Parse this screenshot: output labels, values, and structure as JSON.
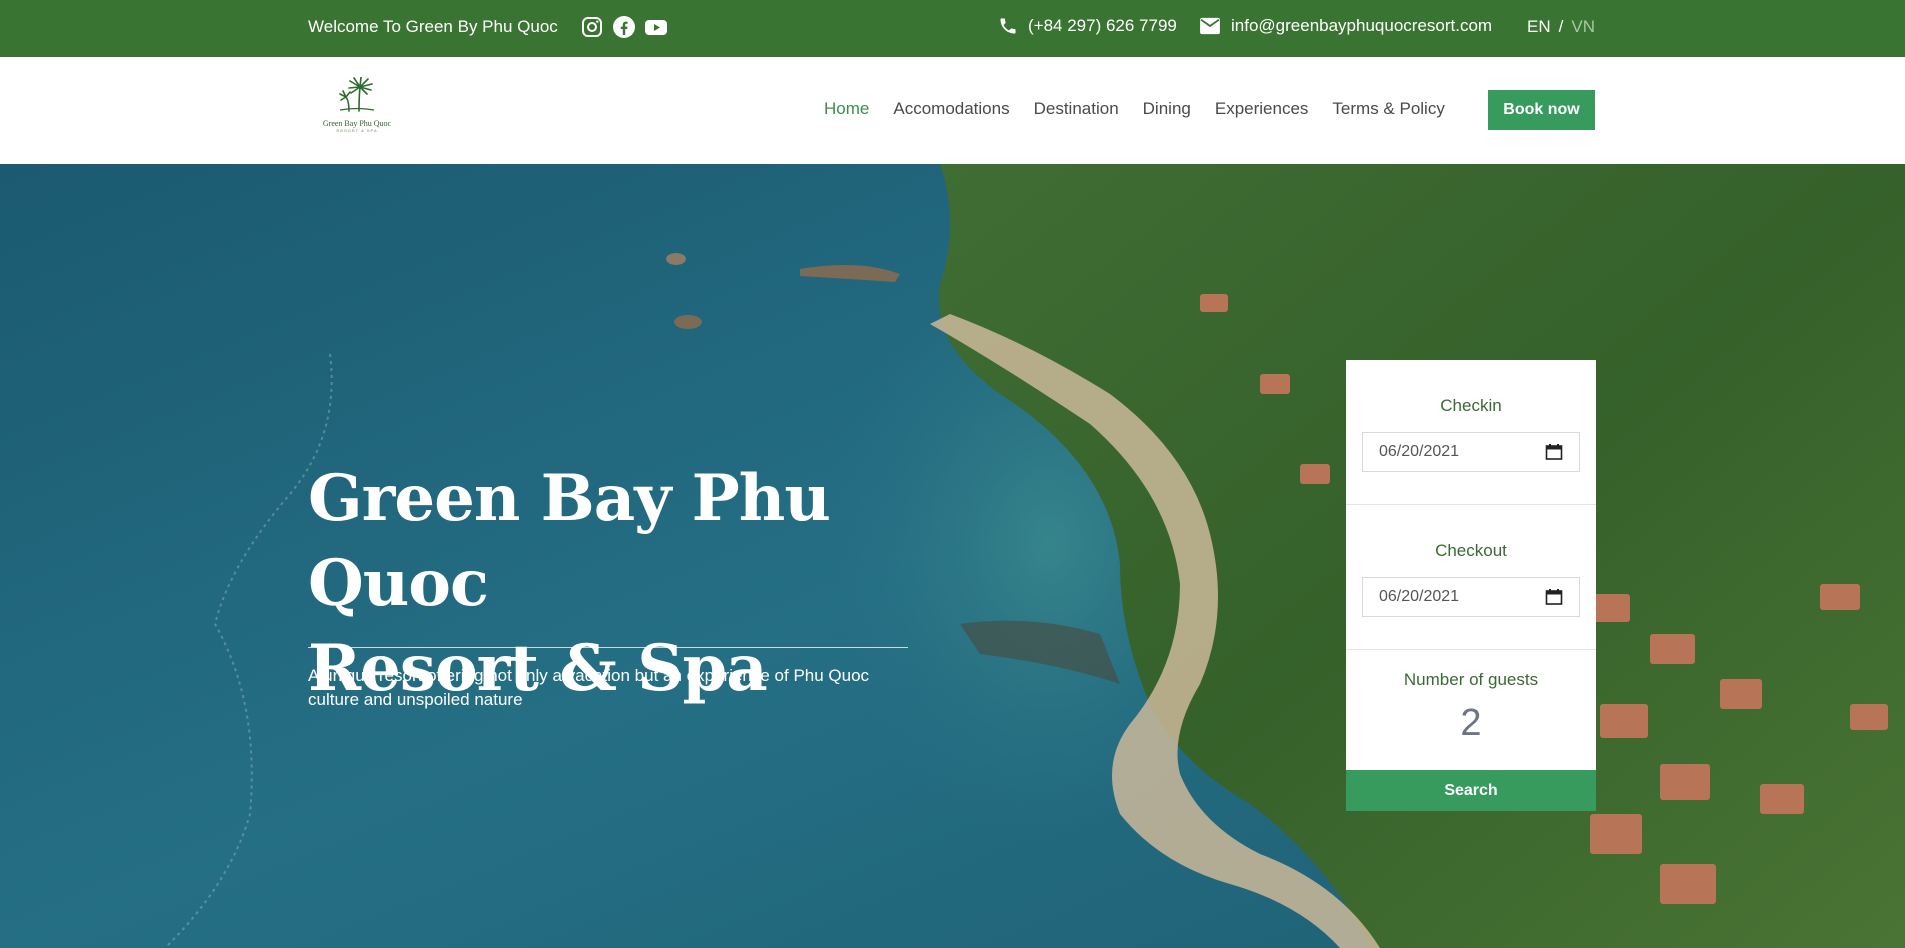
{
  "topbar": {
    "welcome": "Welcome To Green By Phu Quoc",
    "social_icons": [
      "instagram-icon",
      "facebook-icon",
      "youtube-icon"
    ],
    "phone": "(+84 297) 626 7799",
    "email": "info@greenbayphuquocresort.com",
    "lang_en": "EN",
    "lang_sep": "/",
    "lang_vn": "VN",
    "bg_color": "#3a7432"
  },
  "header": {
    "logo_text": "Green Bay Phu Quoc",
    "logo_sub": "RESORT & SPA",
    "nav": [
      "Home",
      "Accomodations",
      "Destination",
      "Dining",
      "Experiences",
      "Terms & Policy"
    ],
    "book_label": "Book now",
    "accent_color": "#379b5e"
  },
  "hero": {
    "title_line1": "Green Bay Phu Quoc",
    "title_line2": "Resort & Spa",
    "subtitle": "A unique resort offering not only a vacation but an experience of Phu Quoc culture and unspoiled nature"
  },
  "booking": {
    "checkin_label": "Checkin",
    "checkin_value": "06/20/2021",
    "checkout_label": "Checkout",
    "checkout_value": "06/20/2021",
    "guests_label": "Number of guests",
    "guests_value": "2",
    "search_label": "Search"
  }
}
